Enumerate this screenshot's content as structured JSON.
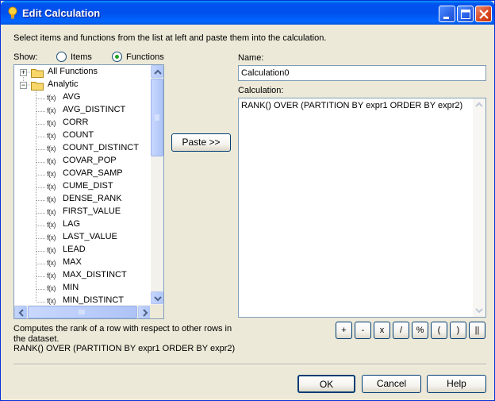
{
  "window": {
    "title": "Edit Calculation",
    "icon": "lightbulb-icon",
    "controls": [
      "minimize-icon",
      "maximize-icon",
      "close-icon"
    ]
  },
  "instructions": "Select items and functions from the list at left and paste them into the calculation.",
  "show": {
    "label": "Show:",
    "options": [
      "Items",
      "Functions"
    ],
    "selected": "Functions"
  },
  "tree": {
    "root_items": [
      {
        "label": "All Functions",
        "expanded": false
      },
      {
        "label": "Analytic",
        "expanded": true
      }
    ],
    "functions": [
      "AVG",
      "AVG_DISTINCT",
      "CORR",
      "COUNT",
      "COUNT_DISTINCT",
      "COVAR_POP",
      "COVAR_SAMP",
      "CUME_DIST",
      "DENSE_RANK",
      "FIRST_VALUE",
      "LAG",
      "LAST_VALUE",
      "LEAD",
      "MAX",
      "MAX_DISTINCT",
      "MIN",
      "MIN_DISTINCT"
    ],
    "function_prefix": "f(x)"
  },
  "paste_button": "Paste >>",
  "name": {
    "label": "Name:",
    "value": "Calculation0"
  },
  "calculation": {
    "label": "Calculation:",
    "value": "RANK() OVER (PARTITION BY expr1 ORDER BY expr2)"
  },
  "description": {
    "line1": "Computes the rank of a row with respect to other rows in the dataset.",
    "line2": "RANK() OVER (PARTITION BY expr1 ORDER BY expr2)"
  },
  "operators": [
    "+",
    "-",
    "x",
    "/",
    "%",
    "(",
    ")",
    "||"
  ],
  "buttons": {
    "ok": "OK",
    "cancel": "Cancel",
    "help": "Help"
  },
  "colors": {
    "titlebar": "#0054e3",
    "dialog": "#ece9d8",
    "radio_dot": "#21a121"
  }
}
